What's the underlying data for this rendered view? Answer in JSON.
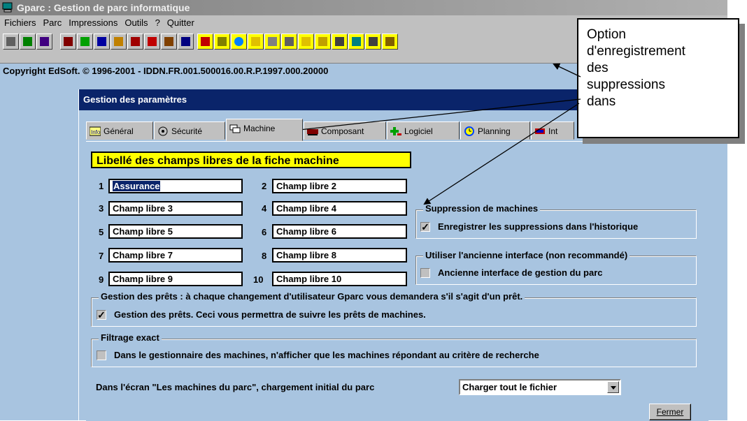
{
  "window": {
    "title": "Gparc : Gestion de parc informatique"
  },
  "menu": [
    "Fichiers",
    "Parc",
    "Impressions",
    "Outils",
    "?",
    "Quitter"
  ],
  "copyright": "Copyright EdSoft. © 1996-2001 - IDDN.FR.001.500016.00.R.P.1997.000.20000",
  "dialog": {
    "title": "Gestion des paramètres",
    "tabs": [
      {
        "label": "Général",
        "icon": "info-icon"
      },
      {
        "label": "Sécurité",
        "icon": "lock-icon"
      },
      {
        "label": "Machine",
        "icon": "machine-icon"
      },
      {
        "label": "Composant",
        "icon": "component-icon"
      },
      {
        "label": "Logiciel",
        "icon": "software-icon"
      },
      {
        "label": "Planning",
        "icon": "clock-icon"
      },
      {
        "label": "Int",
        "icon": "interface-icon"
      }
    ],
    "active_tab": "Machine",
    "banner": "Libellé des champs libres de la fiche machine",
    "fields": [
      {
        "num": "1",
        "value": "Assurance"
      },
      {
        "num": "2",
        "value": "Champ libre 2"
      },
      {
        "num": "3",
        "value": "Champ libre 3"
      },
      {
        "num": "4",
        "value": "Champ libre 4"
      },
      {
        "num": "5",
        "value": "Champ libre 5"
      },
      {
        "num": "6",
        "value": "Champ libre 6"
      },
      {
        "num": "7",
        "value": "Champ libre 7"
      },
      {
        "num": "8",
        "value": "Champ libre 8"
      },
      {
        "num": "9",
        "value": "Champ libre 9"
      },
      {
        "num": "10",
        "value": "Champ libre 10"
      }
    ],
    "groups": {
      "suppression": {
        "title": "Suppression de machines",
        "label": "Enregistrer les suppressions dans l'historique",
        "checked": true
      },
      "interface": {
        "title": "Utiliser l'ancienne interface (non recommandé)",
        "label": "Ancienne interface de gestion du parc",
        "checked": false
      },
      "prets": {
        "title": "Gestion des prêts : à chaque changement d'utilisateur Gparc vous demandera s'il s'agit d'un prêt.",
        "label": "Gestion des prêts. Ceci vous permettra de suivre les prêts de machines.",
        "checked": true
      },
      "filtrage": {
        "title": "Filtrage exact",
        "label": "Dans le gestionnaire des machines, n'afficher que les machines répondant au critère de recherche",
        "checked": false
      }
    },
    "chargement_label": "Dans l'écran \"Les machines du parc\", chargement initial du parc",
    "chargement_value": "Charger tout le fichier",
    "close_button": "Fermer"
  },
  "callout": {
    "lines": [
      "Option",
      "d'enregistrement",
      "des",
      "suppressions",
      "dans"
    ]
  },
  "colors": {
    "background": "#a8c4e0",
    "dialog_title": "#0a246a",
    "banner": "#ffff00"
  }
}
